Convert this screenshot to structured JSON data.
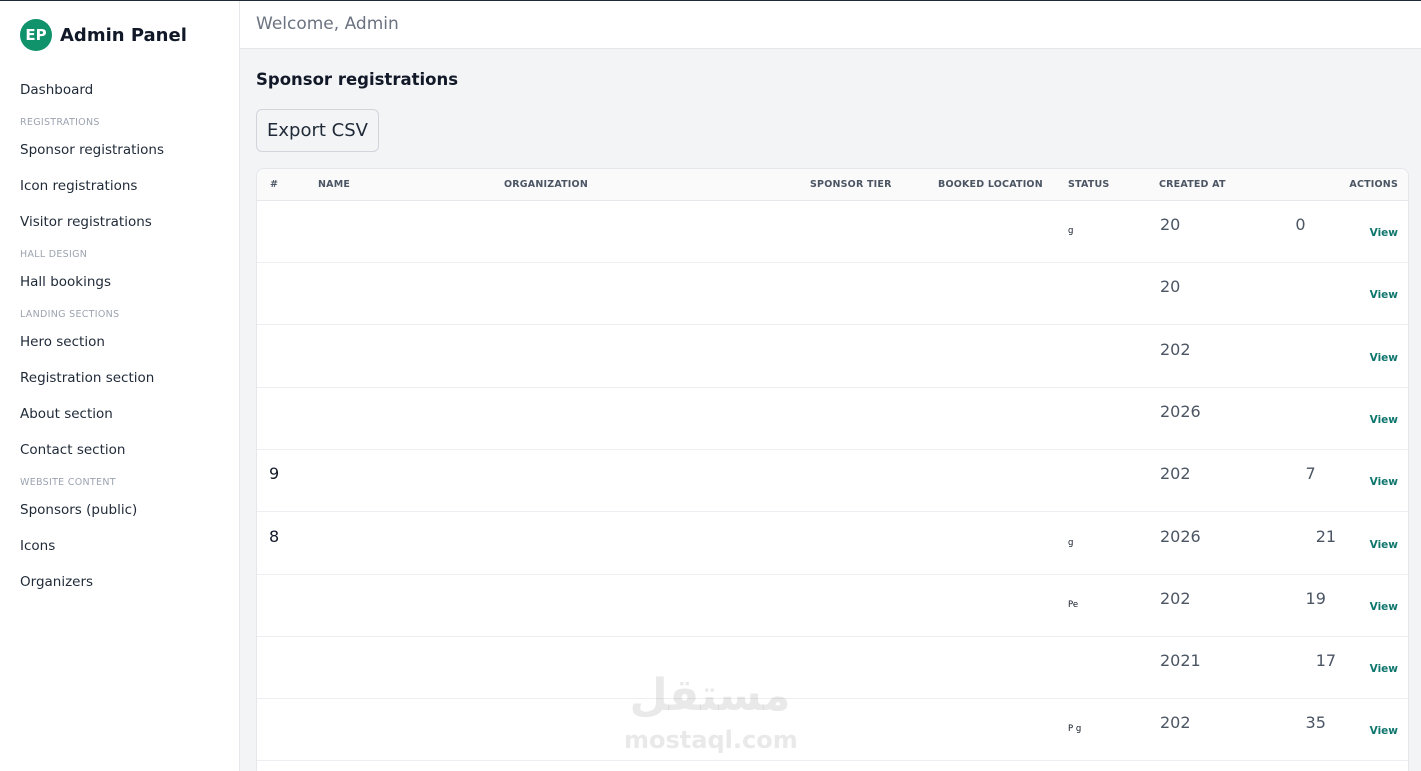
{
  "brand": {
    "logo_text": "EP",
    "name": "Admin Panel",
    "logo_color": "#10936b"
  },
  "sidebar": {
    "entries": [
      {
        "type": "item",
        "label": "Dashboard"
      },
      {
        "type": "group",
        "label": "REGISTRATIONS"
      },
      {
        "type": "item",
        "label": "Sponsor registrations"
      },
      {
        "type": "item",
        "label": "Icon registrations"
      },
      {
        "type": "item",
        "label": "Visitor registrations"
      },
      {
        "type": "group",
        "label": "HALL DESIGN"
      },
      {
        "type": "item",
        "label": "Hall bookings"
      },
      {
        "type": "group",
        "label": "LANDING SECTIONS"
      },
      {
        "type": "item",
        "label": "Hero section"
      },
      {
        "type": "item",
        "label": "Registration section"
      },
      {
        "type": "item",
        "label": "About section"
      },
      {
        "type": "item",
        "label": "Contact section"
      },
      {
        "type": "group",
        "label": "WEBSITE CONTENT"
      },
      {
        "type": "item",
        "label": "Sponsors (public)"
      },
      {
        "type": "item",
        "label": "Icons"
      },
      {
        "type": "item",
        "label": "Organizers"
      }
    ]
  },
  "header": {
    "welcome": "Welcome, Admin"
  },
  "main": {
    "title": "Sponsor registrations",
    "export_label": "Export CSV",
    "table": {
      "columns": {
        "num": "#",
        "name": "NAME",
        "organization": "ORGANIZATION",
        "tier": "SPONSOR TIER",
        "location": "BOOKED LOCATION",
        "status": "STATUS",
        "created": "CREATED AT",
        "actions": "ACTIONS"
      },
      "rows": [
        {
          "num": "",
          "status": "g",
          "created": "20",
          "created_end": "0",
          "action": "View"
        },
        {
          "num": "",
          "status": "",
          "created": "20",
          "created_end": "",
          "action": "View"
        },
        {
          "num": "",
          "status": "",
          "created": "202",
          "created_end": "",
          "action": "View"
        },
        {
          "num": "",
          "status": "",
          "created": "2026",
          "created_end": "",
          "action": "View"
        },
        {
          "num": "9",
          "status": "",
          "created": "202",
          "created_end": "7",
          "action": "View"
        },
        {
          "num": "8",
          "status": "g",
          "created": "2026",
          "created_end": "21",
          "action": "View"
        },
        {
          "num": "",
          "status": "Pe",
          "created": "202",
          "created_end": "19",
          "action": "View"
        },
        {
          "num": "",
          "status": "",
          "created": "2021",
          "created_end": "17",
          "action": "View"
        },
        {
          "num": "",
          "status": "P g",
          "created": "202",
          "created_end": "35",
          "action": "View"
        }
      ]
    }
  },
  "watermark": {
    "arabic": "مستقل",
    "latin": "mostaql.com"
  }
}
